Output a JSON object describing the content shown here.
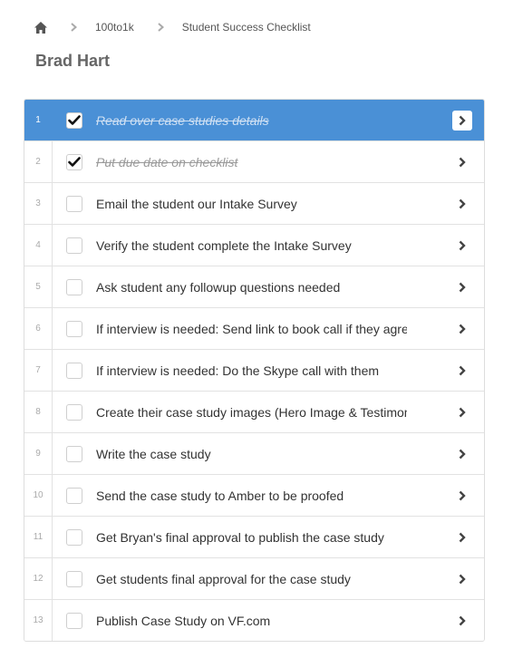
{
  "breadcrumb": {
    "home_icon": "home-icon",
    "items": [
      "100to1k",
      "Student Success Checklist"
    ]
  },
  "title": "Brad Hart",
  "colors": {
    "active_row": "#4a90d6"
  },
  "tasks": [
    {
      "num": "1",
      "label": "Read over case studies details",
      "checked": true,
      "active": true
    },
    {
      "num": "2",
      "label": "Put due date on checklist",
      "checked": true,
      "active": false
    },
    {
      "num": "3",
      "label": "Email the student our Intake Survey",
      "checked": false,
      "active": false
    },
    {
      "num": "4",
      "label": "Verify the student complete the Intake Survey",
      "checked": false,
      "active": false
    },
    {
      "num": "5",
      "label": "Ask student any followup questions needed",
      "checked": false,
      "active": false
    },
    {
      "num": "6",
      "label": "If interview is needed: Send link to book call if they agree",
      "checked": false,
      "active": false
    },
    {
      "num": "7",
      "label": "If interview is needed: Do the Skype call with them",
      "checked": false,
      "active": false
    },
    {
      "num": "8",
      "label": "Create their case study images (Hero Image & Testimonial)",
      "checked": false,
      "active": false
    },
    {
      "num": "9",
      "label": "Write the case study",
      "checked": false,
      "active": false
    },
    {
      "num": "10",
      "label": "Send the case study to Amber to be proofed",
      "checked": false,
      "active": false
    },
    {
      "num": "11",
      "label": "Get Bryan's final approval to publish the case study",
      "checked": false,
      "active": false
    },
    {
      "num": "12",
      "label": "Get students final approval for the case study",
      "checked": false,
      "active": false
    },
    {
      "num": "13",
      "label": "Publish Case Study on VF.com",
      "checked": false,
      "active": false
    }
  ]
}
